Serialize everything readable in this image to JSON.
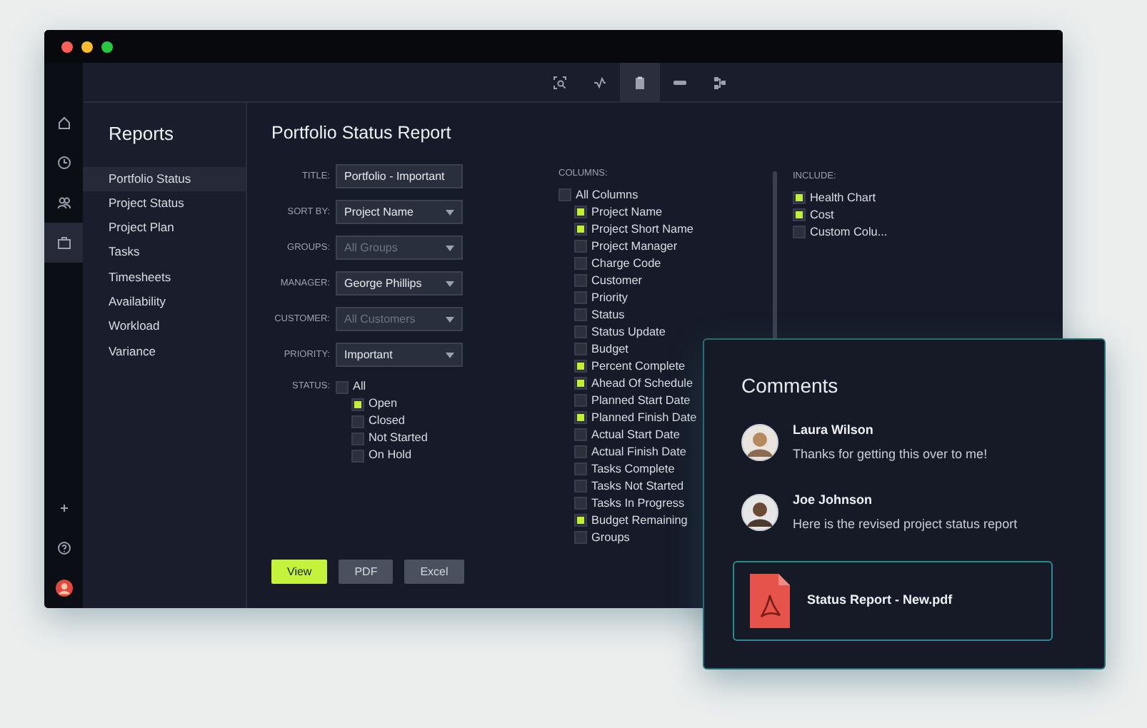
{
  "toolbar": {
    "tools": [
      {
        "kind": "find",
        "selected": false
      },
      {
        "kind": "pulse",
        "selected": false
      },
      {
        "kind": "clipboard",
        "selected": true
      },
      {
        "kind": "bar",
        "selected": false
      },
      {
        "kind": "flow",
        "selected": false
      }
    ]
  },
  "rail": {
    "items": [
      {
        "kind": "home",
        "selected": false
      },
      {
        "kind": "clock",
        "selected": false
      },
      {
        "kind": "people",
        "selected": false
      },
      {
        "kind": "briefcase",
        "selected": true
      }
    ],
    "bottom": [
      {
        "kind": "plus"
      },
      {
        "kind": "help"
      },
      {
        "kind": "avatar"
      }
    ]
  },
  "sidebar": {
    "title": "Reports",
    "items": [
      {
        "label": "Portfolio Status",
        "selected": true
      },
      {
        "label": "Project Status",
        "selected": false
      },
      {
        "label": "Project Plan",
        "selected": false
      },
      {
        "label": "Tasks",
        "selected": false
      },
      {
        "label": "Timesheets",
        "selected": false
      },
      {
        "label": "Availability",
        "selected": false
      },
      {
        "label": "Workload",
        "selected": false
      },
      {
        "label": "Variance",
        "selected": false
      }
    ]
  },
  "report": {
    "title": "Portfolio Status Report",
    "fields": [
      {
        "label": "TITLE:",
        "kind": "text",
        "value": "Portfolio - Important",
        "dimmed": false
      },
      {
        "label": "SORT BY:",
        "kind": "select",
        "value": "Project Name",
        "dimmed": false
      },
      {
        "label": "GROUPS:",
        "kind": "select",
        "value": "All Groups",
        "dimmed": true
      },
      {
        "label": "MANAGER:",
        "kind": "select",
        "value": "George Phillips",
        "dimmed": false
      },
      {
        "label": "CUSTOMER:",
        "kind": "select",
        "value": "All Customers",
        "dimmed": true
      },
      {
        "label": "PRIORITY:",
        "kind": "select",
        "value": "Important",
        "dimmed": false
      }
    ],
    "status": {
      "label": "STATUS:",
      "all": {
        "label": "All",
        "checked": false
      },
      "options": [
        {
          "label": "Open",
          "checked": true
        },
        {
          "label": "Closed",
          "checked": false
        },
        {
          "label": "Not Started",
          "checked": false
        },
        {
          "label": "On Hold",
          "checked": false
        }
      ]
    },
    "columns": {
      "label": "COLUMNS:",
      "all": {
        "label": "All Columns",
        "checked": false
      },
      "options": [
        {
          "label": "Project Name",
          "checked": true
        },
        {
          "label": "Project Short Name",
          "checked": true
        },
        {
          "label": "Project Manager",
          "checked": false
        },
        {
          "label": "Charge Code",
          "checked": false
        },
        {
          "label": "Customer",
          "checked": false
        },
        {
          "label": "Priority",
          "checked": false
        },
        {
          "label": "Status",
          "checked": false
        },
        {
          "label": "Status Update",
          "checked": false
        },
        {
          "label": "Budget",
          "checked": false
        },
        {
          "label": "Percent Complete",
          "checked": true
        },
        {
          "label": "Ahead Of Schedule",
          "checked": true
        },
        {
          "label": "Planned Start Date",
          "checked": false
        },
        {
          "label": "Planned Finish Date",
          "checked": true
        },
        {
          "label": "Actual Start Date",
          "checked": false
        },
        {
          "label": "Actual Finish Date",
          "checked": false
        },
        {
          "label": "Tasks Complete",
          "checked": false
        },
        {
          "label": "Tasks Not Started",
          "checked": false
        },
        {
          "label": "Tasks In Progress",
          "checked": false
        },
        {
          "label": "Budget Remaining",
          "checked": true
        },
        {
          "label": "Groups",
          "checked": false
        }
      ]
    },
    "include": {
      "label": "INCLUDE:",
      "options": [
        {
          "label": "Health Chart",
          "checked": true
        },
        {
          "label": "Cost",
          "checked": true
        },
        {
          "label": "Custom Colu...",
          "checked": false
        }
      ]
    },
    "buttons": [
      {
        "label": "View",
        "kind": "primary"
      },
      {
        "label": "PDF",
        "kind": "secondary"
      },
      {
        "label": "Excel",
        "kind": "secondary"
      }
    ]
  },
  "comments": {
    "title": "Comments",
    "items": [
      {
        "name": "Laura Wilson",
        "text": "Thanks for getting this over to me!"
      },
      {
        "name": "Joe Johnson",
        "text": "Here is the revised project status report"
      }
    ],
    "attachment": {
      "name": "Status Report - New.pdf"
    }
  }
}
